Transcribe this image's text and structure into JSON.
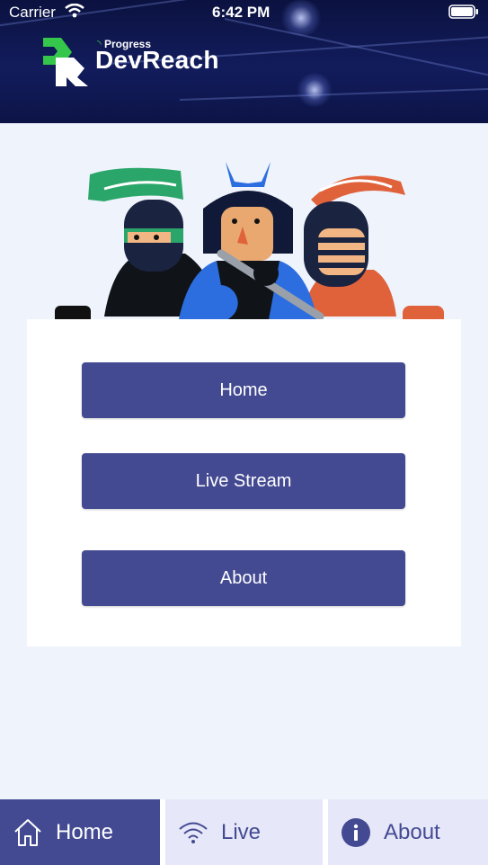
{
  "status_bar": {
    "carrier": "Carrier",
    "time": "6:42 PM"
  },
  "header": {
    "logo_progress": "Progress",
    "logo_brand": "DevReach",
    "logo_icon": "devreach-logo"
  },
  "menu": {
    "buttons": [
      {
        "label": "Home"
      },
      {
        "label": "Live Stream"
      },
      {
        "label": "About"
      }
    ]
  },
  "tabbar": {
    "tabs": [
      {
        "label": "Home",
        "icon": "home-icon",
        "active": true
      },
      {
        "label": "Live",
        "icon": "wifi-icon",
        "active": false
      },
      {
        "label": "About",
        "icon": "info-icon",
        "active": false
      }
    ]
  },
  "colors": {
    "primary": "#434a92",
    "background": "#eef3fc",
    "tab_inactive_bg": "#e6e7f8",
    "header_bg": "#0c1446"
  }
}
